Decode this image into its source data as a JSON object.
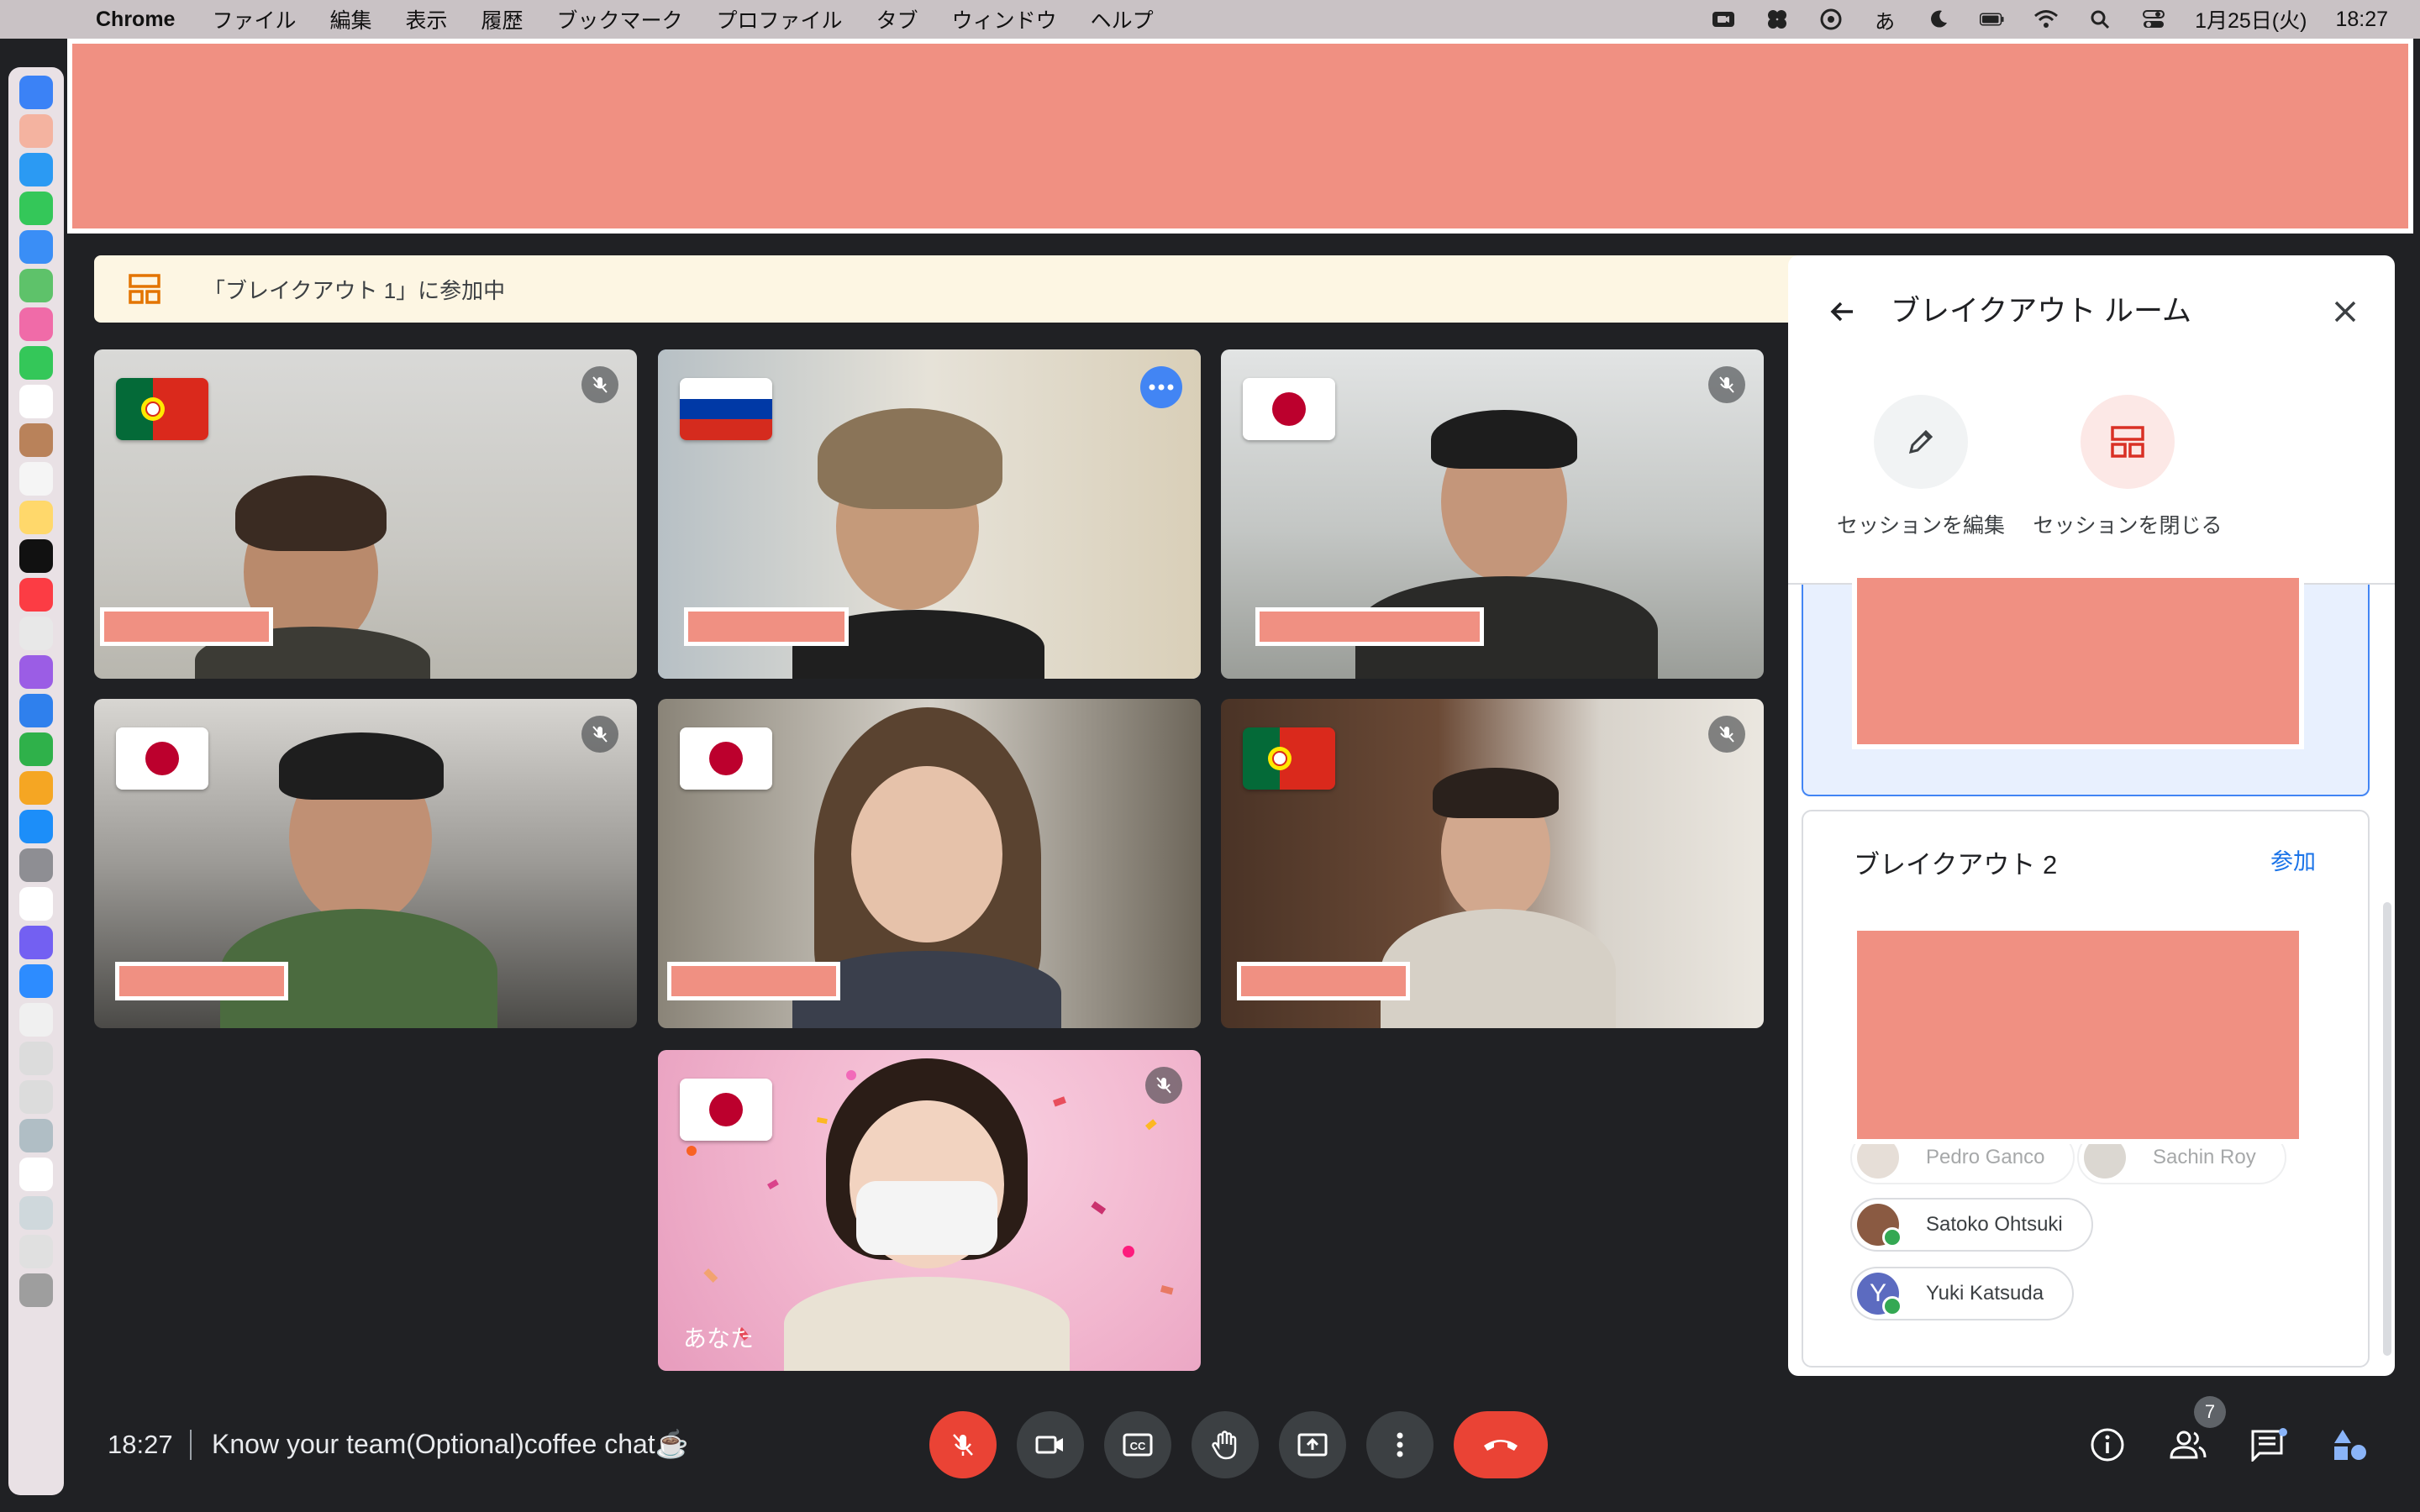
{
  "menubar": {
    "app": "Chrome",
    "items": [
      "ファイル",
      "編集",
      "表示",
      "履歴",
      "ブックマーク",
      "プロファイル",
      "タブ",
      "ウィンドウ",
      "ヘルプ"
    ],
    "input_method": "あ",
    "date": "1月25日(火)",
    "time": "18:27"
  },
  "banner": {
    "text": "「ブレイクアウト 1」に参加中"
  },
  "tiles": [
    {
      "flag": "portugal",
      "muted": true
    },
    {
      "flag": "russia",
      "muted": false,
      "active": true
    },
    {
      "flag": "japan",
      "muted": true
    },
    {
      "flag": "japan",
      "muted": true
    },
    {
      "flag": "japan",
      "muted": false
    },
    {
      "flag": "portugal",
      "muted": true
    },
    {
      "flag": "japan",
      "muted": true,
      "you_label": "あなた"
    }
  ],
  "panel": {
    "title": "ブレイクアウト ルーム",
    "edit_label": "セッションを編集",
    "close_label": "セッションを閉じる",
    "room2": {
      "title": "ブレイクアウト 2",
      "join": "参加",
      "participants": [
        {
          "name": "Pedro Ganco",
          "faded": true
        },
        {
          "name": "Sachin Roy",
          "faded": true
        },
        {
          "name": "Satoko Ohtsuki",
          "faded": false
        },
        {
          "name": "Yuki Katsuda",
          "initial": "Y",
          "faded": false
        }
      ]
    }
  },
  "bottombar": {
    "time": "18:27",
    "meeting_title": "Know your team(Optional)coffee chat☕",
    "participant_count": "7"
  },
  "colors": {
    "accent": "#1a73e8",
    "danger": "#ea4335",
    "redaction": "#f09082"
  }
}
